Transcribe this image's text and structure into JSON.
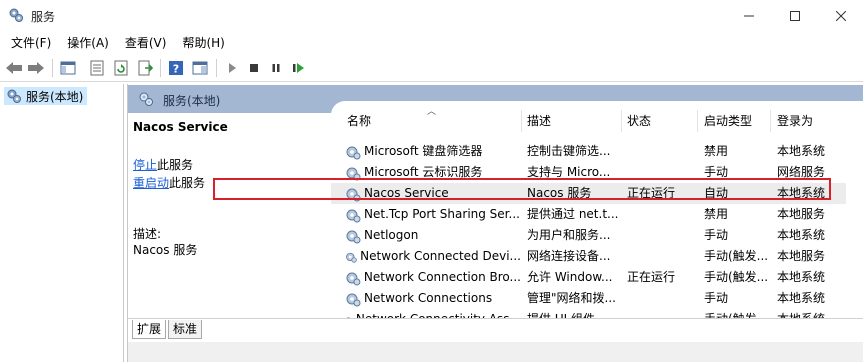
{
  "window": {
    "title": "服务",
    "controls": {
      "minimize": "—",
      "maximize": "☐",
      "close": "✕"
    }
  },
  "menu": [
    {
      "label": "文件(F)"
    },
    {
      "label": "操作(A)"
    },
    {
      "label": "查看(V)"
    },
    {
      "label": "帮助(H)"
    }
  ],
  "toolbar": {
    "icons": [
      "back-arrow-icon",
      "forward-arrow-icon",
      "console-tree-icon",
      "properties-icon",
      "refresh-icon",
      "export-list-icon",
      "help-icon",
      "show-hide-pane-icon",
      "start-service-icon",
      "stop-service-icon",
      "pause-service-icon",
      "restart-service-icon"
    ]
  },
  "tree": {
    "selected_label": "服务(本地)"
  },
  "panel": {
    "header_title": "服务(本地)",
    "selected_service": "Nacos Service",
    "stop_link": "停止",
    "stop_suffix": "此服务",
    "restart_link": "重启动",
    "restart_suffix": "此服务",
    "description_label": "描述:",
    "description_text": "Nacos 服务"
  },
  "list": {
    "columns": {
      "name": "名称",
      "description": "描述",
      "status": "状态",
      "startup": "启动类型",
      "logon": "登录为"
    },
    "rows": [
      {
        "name": "Microsoft 键盘筛选器",
        "description": "控制击键筛选...",
        "status": "",
        "startup": "禁用",
        "logon": "本地系统"
      },
      {
        "name": "Microsoft 云标识服务",
        "description": "支持与 Micro...",
        "status": "",
        "startup": "手动",
        "logon": "网络服务"
      },
      {
        "name": "Nacos Service",
        "description": "Nacos 服务",
        "status": "正在运行",
        "startup": "自动",
        "logon": "本地系统"
      },
      {
        "name": "Net.Tcp Port Sharing Ser...",
        "description": "提供通过 net.t...",
        "status": "",
        "startup": "禁用",
        "logon": "本地服务"
      },
      {
        "name": "Netlogon",
        "description": "为用户和服务...",
        "status": "",
        "startup": "手动",
        "logon": "本地系统"
      },
      {
        "name": "Network Connected Devi...",
        "description": "网络连接设备...",
        "status": "",
        "startup": "手动(触发...",
        "logon": "本地服务"
      },
      {
        "name": "Network Connection Bro...",
        "description": "允许 Window...",
        "status": "正在运行",
        "startup": "手动(触发...",
        "logon": "本地系统"
      },
      {
        "name": "Network Connections",
        "description": "管理\"网络和拨...",
        "status": "",
        "startup": "手动",
        "logon": "本地系统"
      },
      {
        "name": "Network Connectivity Ass...",
        "description": "提供 UI 组件...",
        "status": "",
        "startup": "手动(触发...",
        "logon": "本地系统"
      }
    ]
  },
  "tabs": [
    {
      "label": "扩展"
    },
    {
      "label": "标准"
    }
  ],
  "colors": {
    "header_bg": "#a3b7d3",
    "tree_selected_bg": "#cce8ff",
    "highlight_border": "#d8202a",
    "link": "#1a5ed6"
  }
}
